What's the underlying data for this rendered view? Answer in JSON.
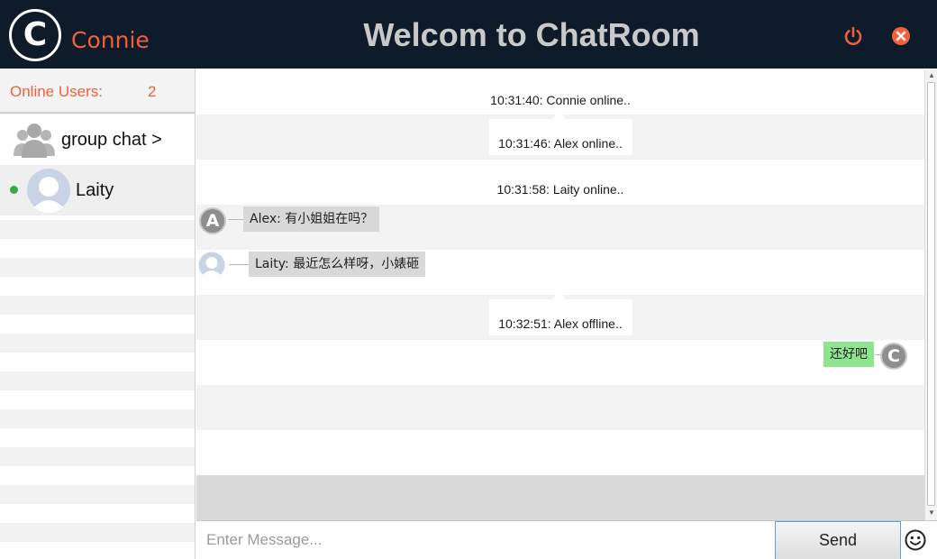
{
  "header": {
    "logo_letter": "C",
    "user_name": "Connie",
    "title": "Welcom to ChatRoom",
    "power_icon": "power-icon",
    "close_icon": "close-icon",
    "accent_color": "#f0603a",
    "bg_color": "#0d1b2a"
  },
  "sidebar": {
    "online_label": "Online Users:",
    "online_count": "2",
    "items": [
      {
        "label": "group chat >",
        "icon": "group-icon"
      },
      {
        "label": "Laity",
        "icon": "avatar-icon",
        "status": "online"
      }
    ]
  },
  "chat": {
    "messages": [
      {
        "type": "system",
        "text": "10:31:40: Connie online.."
      },
      {
        "type": "system",
        "text": "10:31:46: Alex online.."
      },
      {
        "type": "system",
        "text": "10:31:58: Laity online.."
      },
      {
        "type": "incoming",
        "avatar": "A",
        "text": "Alex: 有小姐姐在吗？"
      },
      {
        "type": "incoming",
        "avatar": "laity-avatar",
        "text": "Laity: 最近怎么样呀，小婊砸"
      },
      {
        "type": "system",
        "text": "10:32:51: Alex offline.."
      },
      {
        "type": "outgoing",
        "avatar": "C",
        "text": "还好吧"
      }
    ]
  },
  "input": {
    "placeholder": "Enter Message...",
    "send_label": "Send",
    "emoji_icon": "smiley-icon"
  }
}
